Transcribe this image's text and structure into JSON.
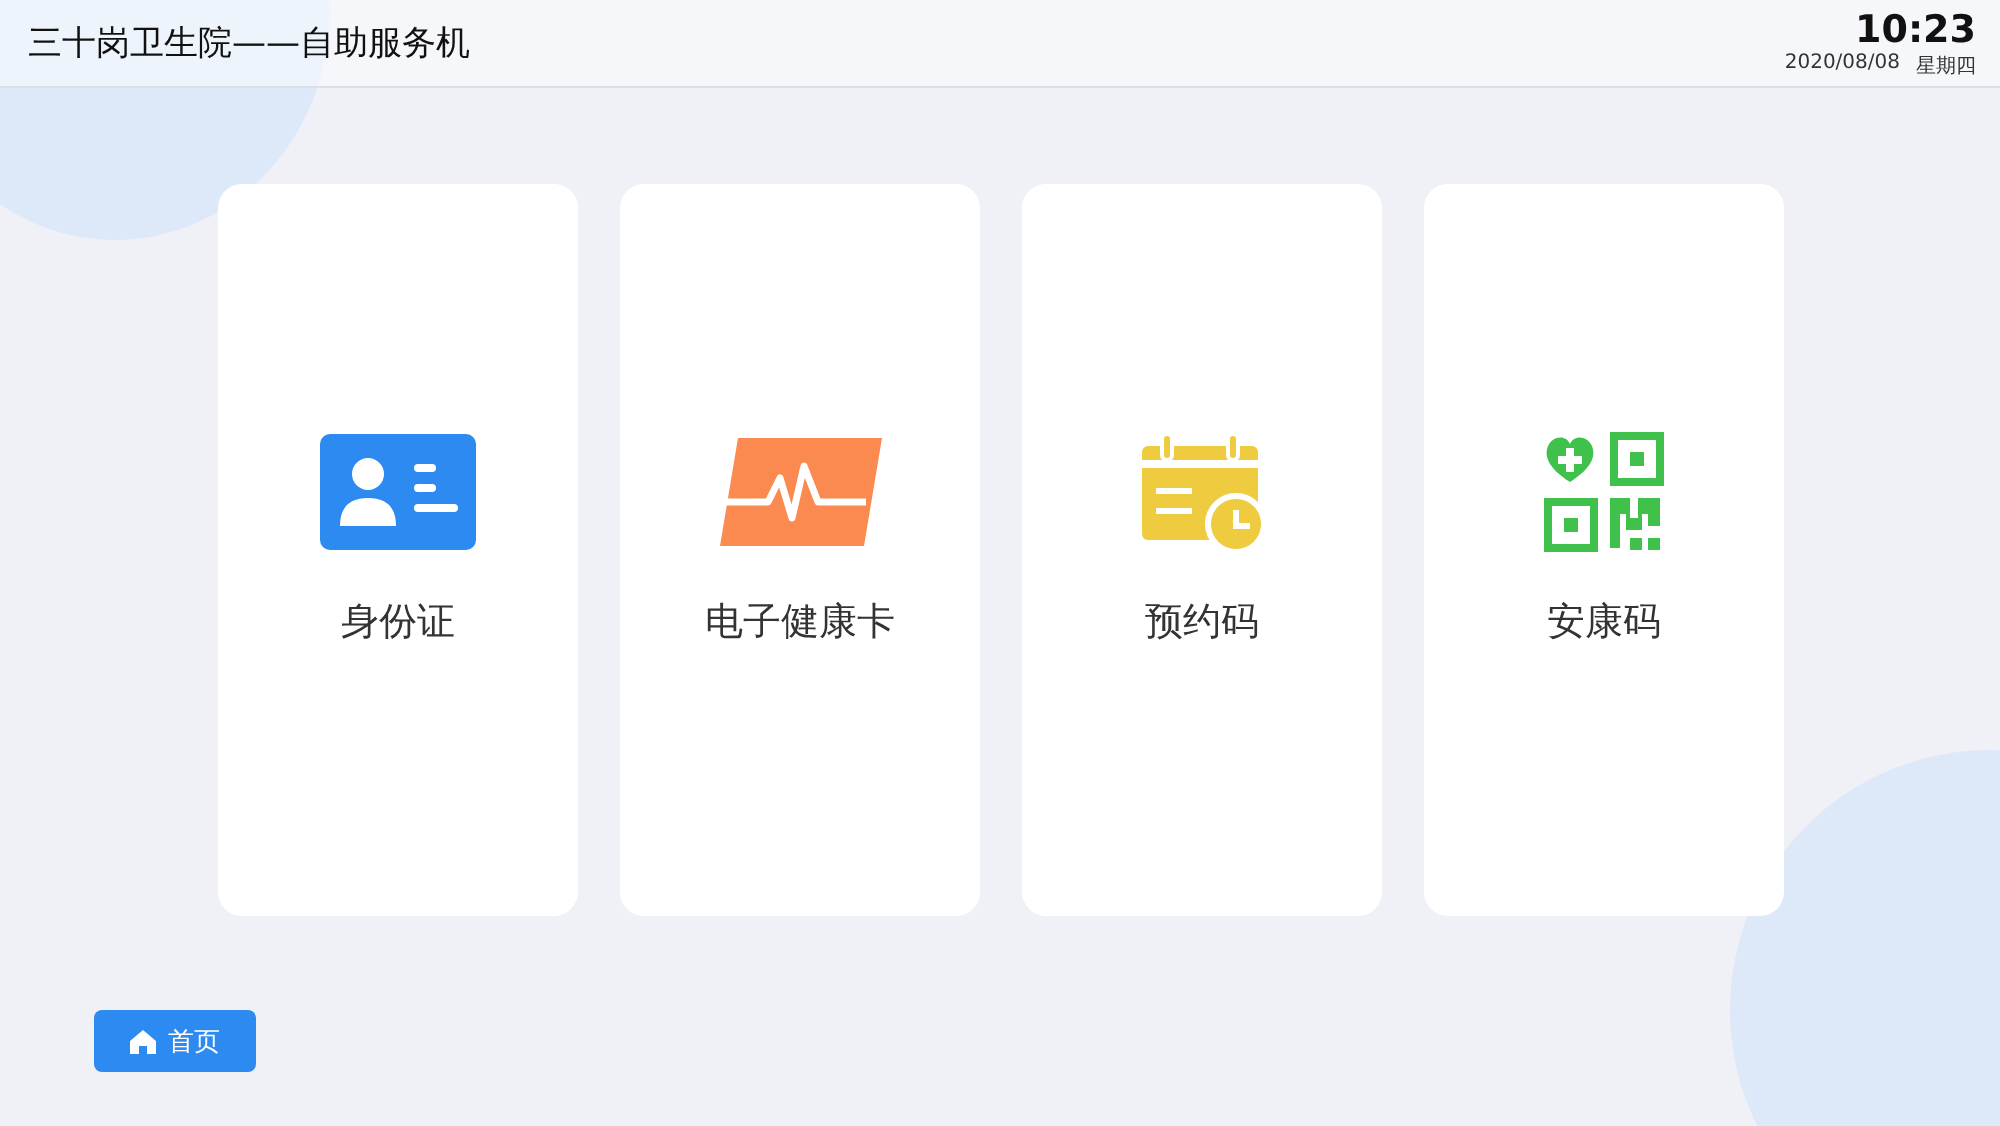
{
  "header": {
    "title": "三十岗卫生院——自助服务机",
    "time": "10:23",
    "date": "2020/08/08",
    "weekday": "星期四"
  },
  "cards": [
    {
      "kind": "id",
      "label": "身份证"
    },
    {
      "kind": "health",
      "label": "电子健康卡"
    },
    {
      "kind": "calendar",
      "label": "预约码"
    },
    {
      "kind": "qr",
      "label": "安康码"
    }
  ],
  "home_button": {
    "label": "首页"
  }
}
